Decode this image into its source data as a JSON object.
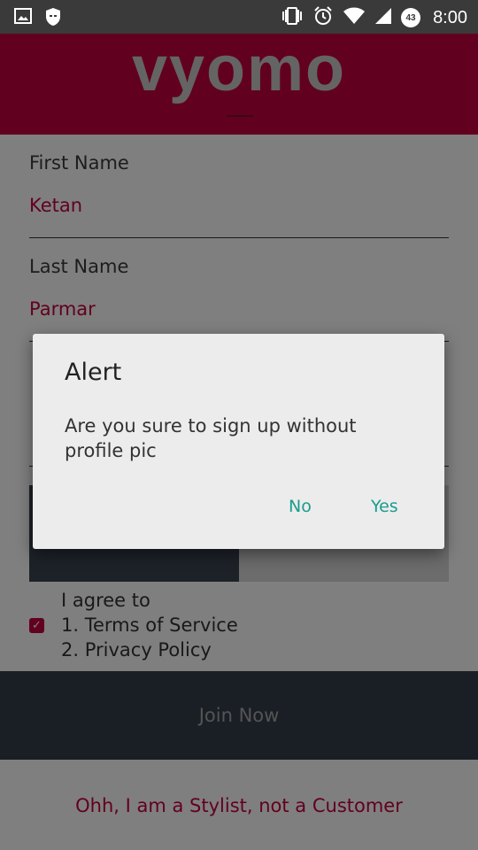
{
  "status_bar": {
    "time": "8:00",
    "battery_level": "43",
    "icons": [
      "image-icon",
      "shield-icon",
      "vibrate-icon",
      "alarm-icon",
      "wifi-icon",
      "signal-icon",
      "battery-icon"
    ]
  },
  "header": {
    "logo": "vyomo"
  },
  "form": {
    "first_name_label": "First Name",
    "first_name_value": "Ketan",
    "last_name_label": "Last Name",
    "last_name_value": "Parmar",
    "agree_line1": "I agree to",
    "agree_line2": "1. Terms of Service",
    "agree_line3": "2. Privacy Policy",
    "agree_checked": true
  },
  "join_button": "Join Now",
  "stylist_link": "Ohh, I am a Stylist, not a Customer",
  "dialog": {
    "title": "Alert",
    "message": "Are you sure to sign up without profile pic",
    "no_label": "No",
    "yes_label": "Yes"
  },
  "colors": {
    "brand": "#c4003e",
    "dialog_button": "#1a9c8e",
    "join_bg": "#353e4b"
  }
}
